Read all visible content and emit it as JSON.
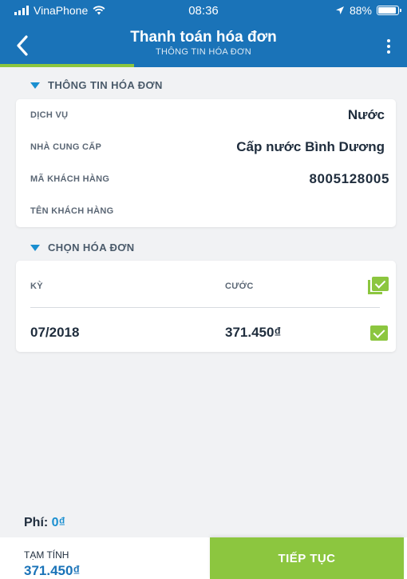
{
  "status_bar": {
    "carrier": "VinaPhone",
    "time": "08:36",
    "battery": "88%"
  },
  "header": {
    "title": "Thanh toán hóa đơn",
    "subtitle": "THÔNG TIN HÓA ĐƠN",
    "progress": 0.33,
    "icons": {
      "back": "chevron-left-icon",
      "menu": "more-vertical-icon"
    }
  },
  "bill_info": {
    "heading": "THÔNG TIN HÓA ĐƠN",
    "rows": [
      {
        "label": "DỊCH VỤ",
        "value": "Nước"
      },
      {
        "label": "NHÀ CUNG CẤP",
        "value": "Cấp nước Bình Dương"
      },
      {
        "label": "MÃ KHÁCH HÀNG",
        "value": "8005128005"
      },
      {
        "label": "TÊN KHÁCH HÀNG",
        "value": ""
      }
    ]
  },
  "bill_select": {
    "heading": "CHỌN HÓA ĐƠN",
    "columns": {
      "period": "KỲ",
      "charge": "CƯỚC"
    },
    "bills": [
      {
        "period": "07/2018",
        "charge": "371.450₫",
        "checked": true
      }
    ]
  },
  "fee": {
    "label": "Phí:",
    "value": "0₫"
  },
  "footer": {
    "total_label": "TẠM TÍNH",
    "total_value": "371.450₫",
    "continue_label": "TIẾP TỤC"
  },
  "colors": {
    "primary": "#1a73b8",
    "accent": "#8cc63f",
    "link": "#1a8fd0",
    "background": "#f1f2f4"
  }
}
